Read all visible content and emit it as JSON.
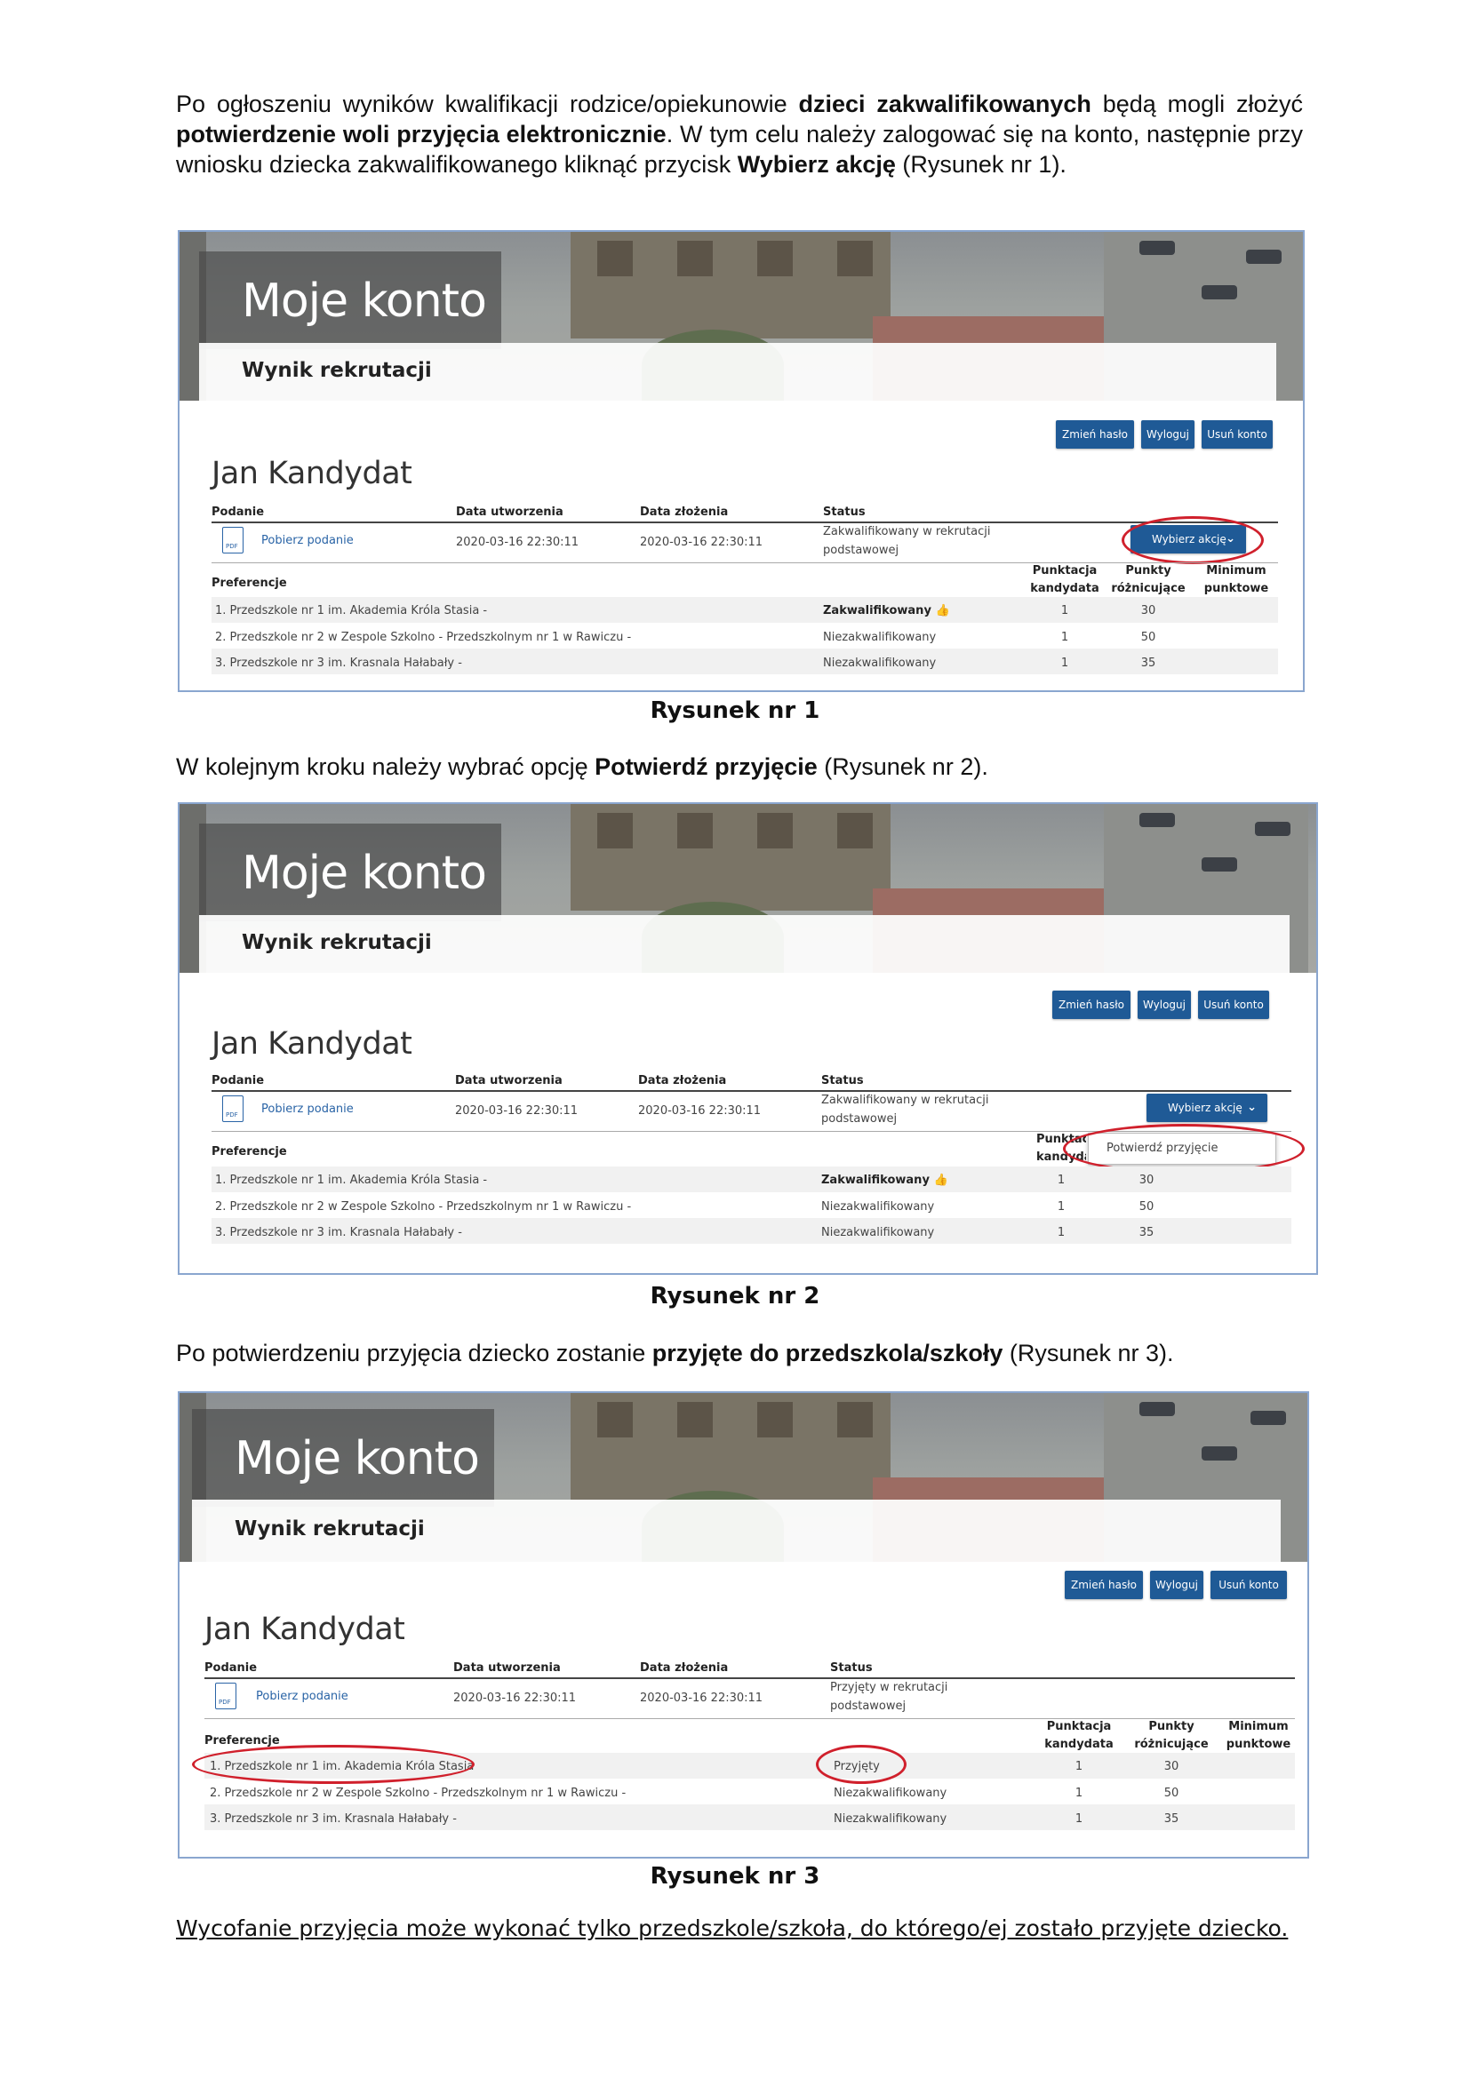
{
  "intro": {
    "p1": "Po ogłoszeniu wyników kwalifikacji rodzice/opiekunowie ",
    "b1": "dzieci zakwalifikowanych",
    "p2": " będą mogli złożyć ",
    "b2": "potwierdzenie woli przyjęcia elektronicznie",
    "p3": ". W tym celu należy zalogować się na konto, następnie przy wniosku dziecka zakwalifikowanego kliknąć przycisk ",
    "b3": "Wybierz akcję",
    "p4": " (Rysunek nr 1)."
  },
  "step2": {
    "p1": "W kolejnym kroku należy wybrać opcję ",
    "b1": "Potwierdź przyjęcie",
    "p2": " (Rysunek nr 2)."
  },
  "step3": {
    "p1": "Po potwierdzeniu przyjęcia dziecko zostanie ",
    "b1": "przyjęte do przedszkola/szkoły",
    "p2": " (Rysunek nr 3)."
  },
  "captions": {
    "fig1": "Rysunek nr 1",
    "fig2": "Rysunek nr 2",
    "fig3": "Rysunek nr 3"
  },
  "final_note": "Wycofanie przyjęcia może wykonać tylko przedszkole/szkoła, do którego/ej zostało przyjęte dziecko.",
  "screen": {
    "hero_title": "Moje konto",
    "hero_subtitle": "Wynik rekrutacji",
    "buttons": {
      "change_password": "Zmień hasło",
      "logout": "Wyloguj",
      "delete_account": "Usuń konto"
    },
    "user_name": "Jan Kandydat",
    "headers": {
      "podanie": "Podanie",
      "created": "Data utworzenia",
      "submitted": "Data złożenia",
      "status": "Status"
    },
    "download_link": "Pobierz podanie",
    "pdf_label": "PDF",
    "date_created": "2020-03-16 22:30:11",
    "date_submitted": "2020-03-16 22:30:11",
    "status_fig1": [
      "Zakwalifikowany w rekrutacji",
      "podstawowej"
    ],
    "status_fig2": [
      "Zakwalifikowany w rekrutacji",
      "podstawowej"
    ],
    "status_fig3": [
      "Przyjęty w rekrutacji",
      "podstawowej"
    ],
    "action_button": "Wybierz akcję",
    "menu_item": "Potwierdź przyjęcie",
    "preferences_label": "Preferencje",
    "col_points_candidate": [
      "Punktacja",
      "kandydata"
    ],
    "col_points_diff": [
      "Punkty",
      "różnicujące"
    ],
    "col_min_points": [
      "Minimum",
      "punktowe"
    ],
    "pref_names": [
      "1. Przedszkole nr 1 im. Akademia Króla Stasia -",
      "2. Przedszkole nr 2 w Zespole Szkolno - Przedszkolnym nr 1 w Rawiczu -",
      "3. Przedszkole nr 3 im. Krasnala Hałabały -"
    ],
    "pref_name_fig3_row1": "1. Przedszkole nr 1 im. Akademia Króla Stasia",
    "pref_status_fig12": [
      "Zakwalifikowany",
      "Niezakwalifikowany",
      "Niezakwalifikowany"
    ],
    "pref_status_fig3": [
      "Przyjęty",
      "Niezakwalifikowany",
      "Niezakwalifikowany"
    ],
    "pref_points": [
      "1",
      "1",
      "1"
    ],
    "pref_diff": [
      "30",
      "50",
      "35"
    ],
    "pref_min": [
      "",
      "",
      ""
    ],
    "thumb_icon": "👍",
    "chevron_icon": "⌄"
  }
}
